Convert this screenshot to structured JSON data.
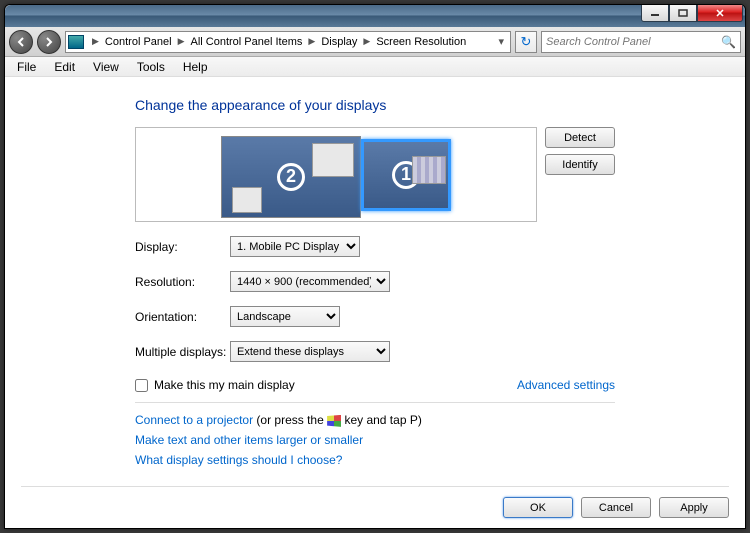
{
  "title_buttons": {
    "min": "min",
    "max": "max",
    "close": "×"
  },
  "breadcrumbs": [
    "Control Panel",
    "All Control Panel Items",
    "Display",
    "Screen Resolution"
  ],
  "search_placeholder": "Search Control Panel",
  "menu": {
    "file": "File",
    "edit": "Edit",
    "view": "View",
    "tools": "Tools",
    "help": "Help"
  },
  "heading": "Change the appearance of your displays",
  "monitors": {
    "primary_num": "1",
    "secondary_num": "2"
  },
  "buttons": {
    "detect": "Detect",
    "identify": "Identify"
  },
  "labels": {
    "display": "Display:",
    "resolution": "Resolution:",
    "orientation": "Orientation:",
    "multiple": "Multiple displays:"
  },
  "selects": {
    "display": "1. Mobile PC Display",
    "resolution": "1440 × 900 (recommended)",
    "orientation": "Landscape",
    "multiple": "Extend these displays"
  },
  "checkbox_label": "Make this my main display",
  "advanced_link": "Advanced settings",
  "projector_link": "Connect to a projector",
  "projector_hint": " (or press the ",
  "projector_hint2": " key and tap P)",
  "larger_link": "Make text and other items larger or smaller",
  "help_link": "What display settings should I choose?",
  "footer": {
    "ok": "OK",
    "cancel": "Cancel",
    "apply": "Apply"
  }
}
